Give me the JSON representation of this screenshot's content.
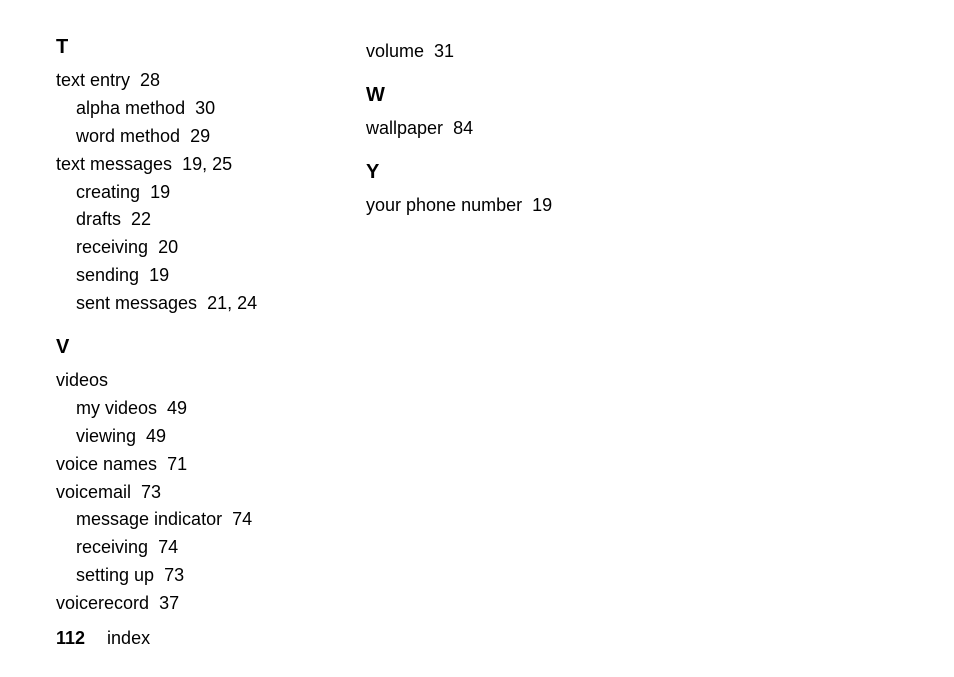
{
  "footer": {
    "page": "112",
    "label": "index"
  },
  "col1": {
    "T": {
      "heading": "T",
      "entries": [
        {
          "text": "text entry",
          "pages": "28",
          "sub": false
        },
        {
          "text": "alpha method",
          "pages": "30",
          "sub": true
        },
        {
          "text": "word method",
          "pages": "29",
          "sub": true
        },
        {
          "text": "text messages",
          "pages": "19, 25",
          "sub": false
        },
        {
          "text": "creating",
          "pages": "19",
          "sub": true
        },
        {
          "text": "drafts",
          "pages": "22",
          "sub": true
        },
        {
          "text": "receiving",
          "pages": "20",
          "sub": true
        },
        {
          "text": "sending",
          "pages": "19",
          "sub": true
        },
        {
          "text": "sent messages",
          "pages": "21, 24",
          "sub": true
        }
      ]
    },
    "V": {
      "heading": "V",
      "entries": [
        {
          "text": "videos",
          "pages": "",
          "sub": false
        },
        {
          "text": "my videos",
          "pages": "49",
          "sub": true
        },
        {
          "text": "viewing",
          "pages": "49",
          "sub": true
        },
        {
          "text": "voice names",
          "pages": "71",
          "sub": false
        },
        {
          "text": "voicemail",
          "pages": "73",
          "sub": false
        },
        {
          "text": "message indicator",
          "pages": "74",
          "sub": true
        },
        {
          "text": "receiving",
          "pages": "74",
          "sub": true
        },
        {
          "text": "setting up",
          "pages": "73",
          "sub": true
        },
        {
          "text": "voicerecord",
          "pages": "37",
          "sub": false
        }
      ]
    }
  },
  "col2": {
    "topEntry": {
      "text": "volume",
      "pages": "31",
      "sub": false
    },
    "W": {
      "heading": "W",
      "entries": [
        {
          "text": "wallpaper",
          "pages": "84",
          "sub": false
        }
      ]
    },
    "Y": {
      "heading": "Y",
      "entries": [
        {
          "text": "your phone number",
          "pages": "19",
          "sub": false
        }
      ]
    }
  }
}
